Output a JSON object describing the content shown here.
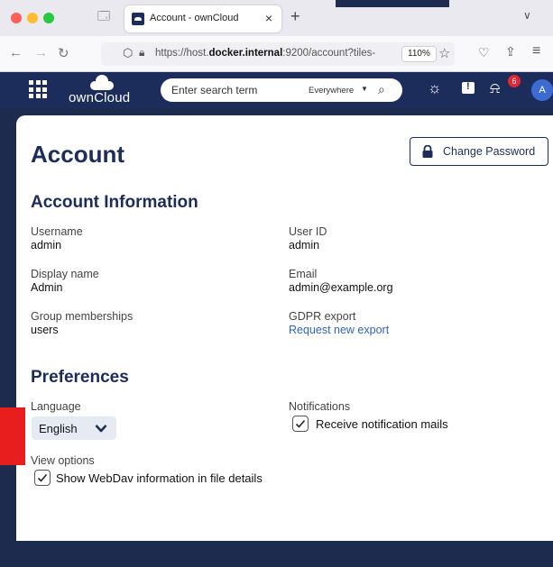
{
  "browser": {
    "tab_title": "Account - ownCloud",
    "tab_close": "×",
    "new_tab": "+",
    "url_prefix": "https://host.",
    "url_host": "docker.internal",
    "url_suffix": ":9200/account?tiles-",
    "zoom": "110%"
  },
  "app": {
    "logo_text": "ownCloud",
    "search_placeholder": "Enter search term",
    "search_scope": "Everywhere",
    "notification_count": "6",
    "avatar_initial": "A"
  },
  "page": {
    "title": "Account",
    "change_password_label": "Change Password"
  },
  "account_info": {
    "heading": "Account Information",
    "username_label": "Username",
    "username_value": "admin",
    "user_id_label": "User ID",
    "user_id_value": "admin",
    "display_name_label": "Display name",
    "display_name_value": "Admin",
    "email_label": "Email",
    "email_value": "admin@example.org",
    "groups_label": "Group memberships",
    "groups_value": "users",
    "gdpr_label": "GDPR export",
    "gdpr_link": "Request new export"
  },
  "preferences": {
    "heading": "Preferences",
    "language_label": "Language",
    "language_value": "English",
    "notifications_label": "Notifications",
    "notifications_checkbox_label": "Receive notification mails",
    "notifications_checked": true,
    "view_options_label": "View options",
    "webdav_checkbox_label": "Show WebDav information in file details",
    "webdav_checked": true
  },
  "colors": {
    "brand_navy": "#1d2d5b",
    "link_blue": "#2d63c7",
    "badge_red": "#e32636",
    "marker_red": "#e81d1d"
  }
}
